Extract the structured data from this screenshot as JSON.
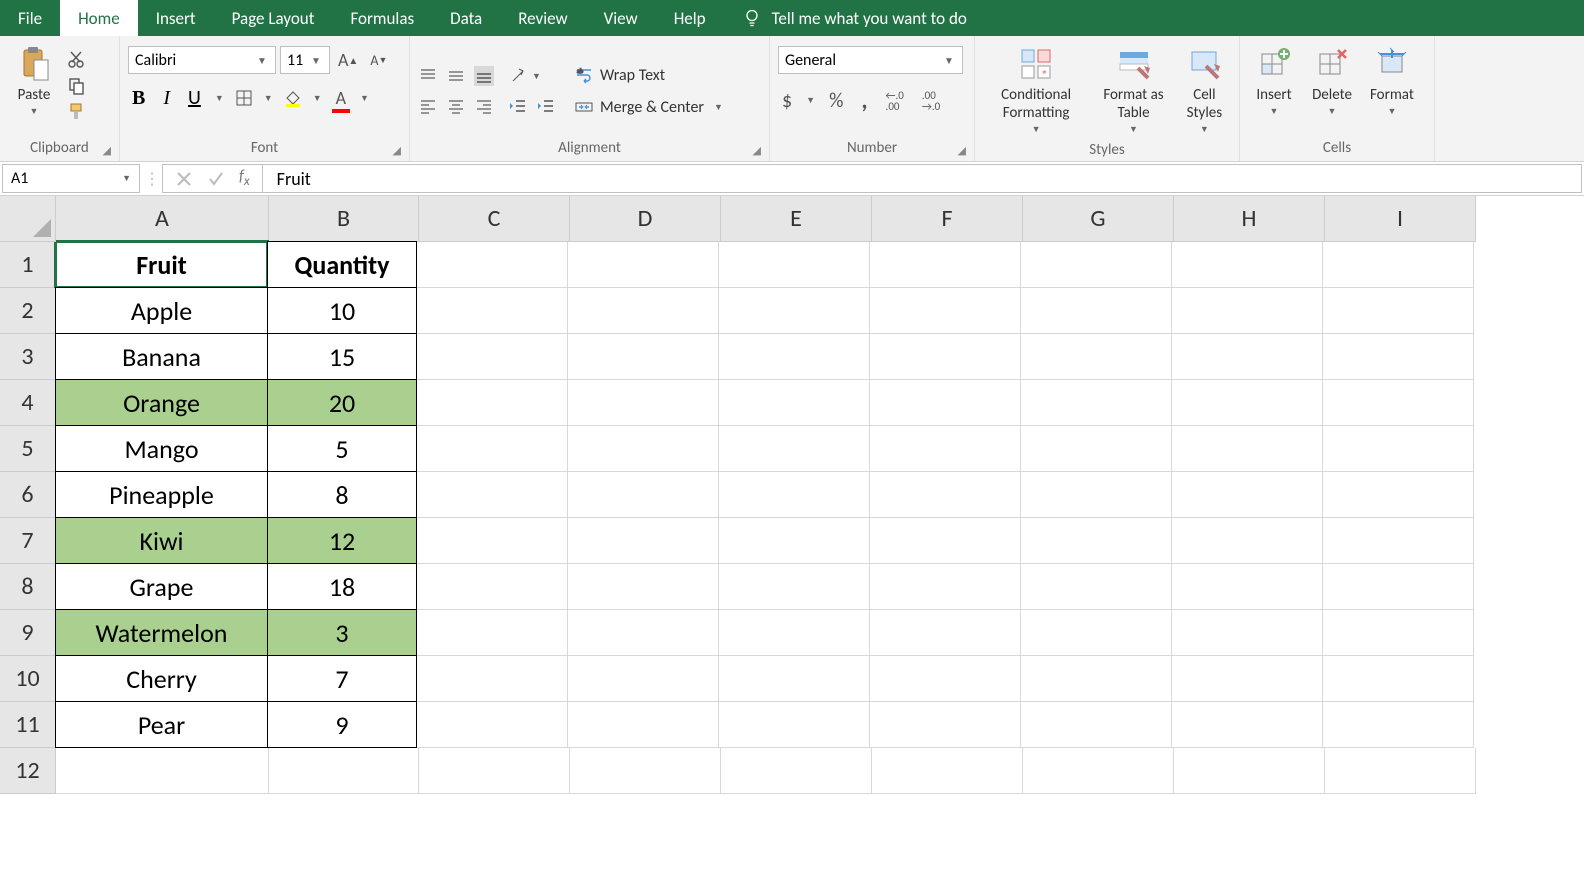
{
  "tabs": [
    "File",
    "Home",
    "Insert",
    "Page Layout",
    "Formulas",
    "Data",
    "Review",
    "View",
    "Help"
  ],
  "active_tab": "Home",
  "tellme": "Tell me what you want to do",
  "ribbon": {
    "clipboard": {
      "paste": "Paste",
      "label": "Clipboard"
    },
    "font": {
      "name": "Calibri",
      "size": "11",
      "label": "Font"
    },
    "alignment": {
      "wrap": "Wrap Text",
      "merge": "Merge & Center",
      "label": "Alignment"
    },
    "number": {
      "format": "General",
      "label": "Number"
    },
    "styles": {
      "cf": "Conditional Formatting",
      "ft": "Format as Table",
      "cs": "Cell Styles",
      "label": "Styles"
    },
    "cells": {
      "insert": "Insert",
      "delete": "Delete",
      "format": "Format",
      "label": "Cells"
    }
  },
  "name_box": "A1",
  "formula_value": "Fruit",
  "columns": [
    "A",
    "B",
    "C",
    "D",
    "E",
    "F",
    "G",
    "H",
    "I"
  ],
  "rows": [
    1,
    2,
    3,
    4,
    5,
    6,
    7,
    8,
    9,
    10,
    11,
    12
  ],
  "table": {
    "headers": [
      "Fruit",
      "Quantity"
    ],
    "data": [
      {
        "fruit": "Apple",
        "qty": "10",
        "hl": false
      },
      {
        "fruit": "Banana",
        "qty": "15",
        "hl": false
      },
      {
        "fruit": "Orange",
        "qty": "20",
        "hl": true
      },
      {
        "fruit": "Mango",
        "qty": "5",
        "hl": false
      },
      {
        "fruit": "Pineapple",
        "qty": "8",
        "hl": false
      },
      {
        "fruit": "Kiwi",
        "qty": "12",
        "hl": true
      },
      {
        "fruit": "Grape",
        "qty": "18",
        "hl": false
      },
      {
        "fruit": "Watermelon",
        "qty": "3",
        "hl": true
      },
      {
        "fruit": "Cherry",
        "qty": "7",
        "hl": false
      },
      {
        "fruit": "Pear",
        "qty": "9",
        "hl": false
      }
    ]
  },
  "selected_cell": "A1"
}
